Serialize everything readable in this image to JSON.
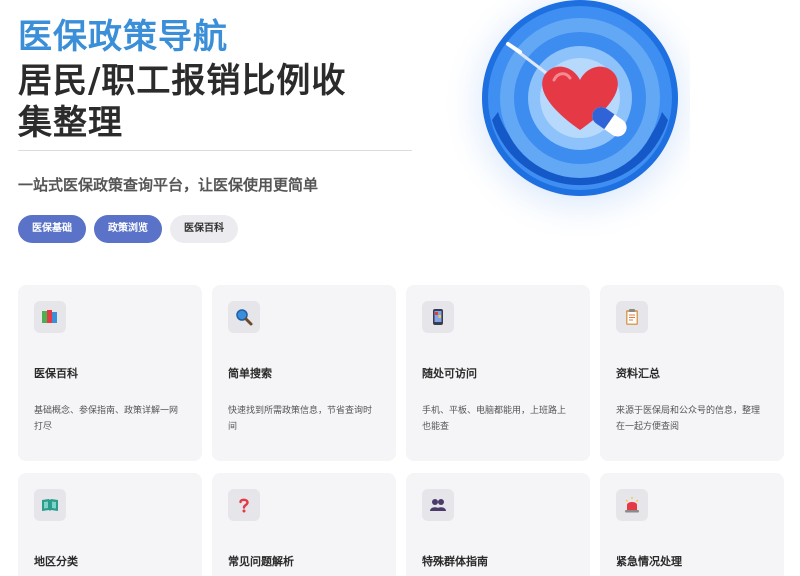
{
  "hero": {
    "title_accent": "医保政策导航",
    "title_main": "居民/职工报销比例收集整理",
    "subtitle": "一站式医保政策查询平台，让医保使用更简单",
    "tags": [
      {
        "label": "医保基础",
        "style": "primary"
      },
      {
        "label": "政策浏览",
        "style": "primary"
      },
      {
        "label": "医保百科",
        "style": "secondary"
      }
    ]
  },
  "colors": {
    "accent_blue": "#3a8fd8",
    "tag_primary": "#5a72c8",
    "card_bg": "#f5f5f7",
    "heart_red": "#e53946"
  },
  "features": [
    {
      "title": "医保百科",
      "desc": "基础概念、参保指南、政策详解一网打尽",
      "icon": "books-icon"
    },
    {
      "title": "简单搜索",
      "desc": "快速找到所需政策信息，节省查询时间",
      "icon": "magnifier-icon"
    },
    {
      "title": "随处可访问",
      "desc": "手机、平板、电脑都能用，上班路上也能查",
      "icon": "mobile-phone-icon"
    },
    {
      "title": "资料汇总",
      "desc": "来源于医保局和公众号的信息，整理在一起方便查阅",
      "icon": "clipboard-icon"
    },
    {
      "title": "地区分类",
      "desc": "",
      "icon": "map-book-icon"
    },
    {
      "title": "常见问题解析",
      "desc": "",
      "icon": "question-mark-icon"
    },
    {
      "title": "特殊群体指南",
      "desc": "",
      "icon": "people-icon"
    },
    {
      "title": "紧急情况处理",
      "desc": "",
      "icon": "siren-icon"
    }
  ]
}
